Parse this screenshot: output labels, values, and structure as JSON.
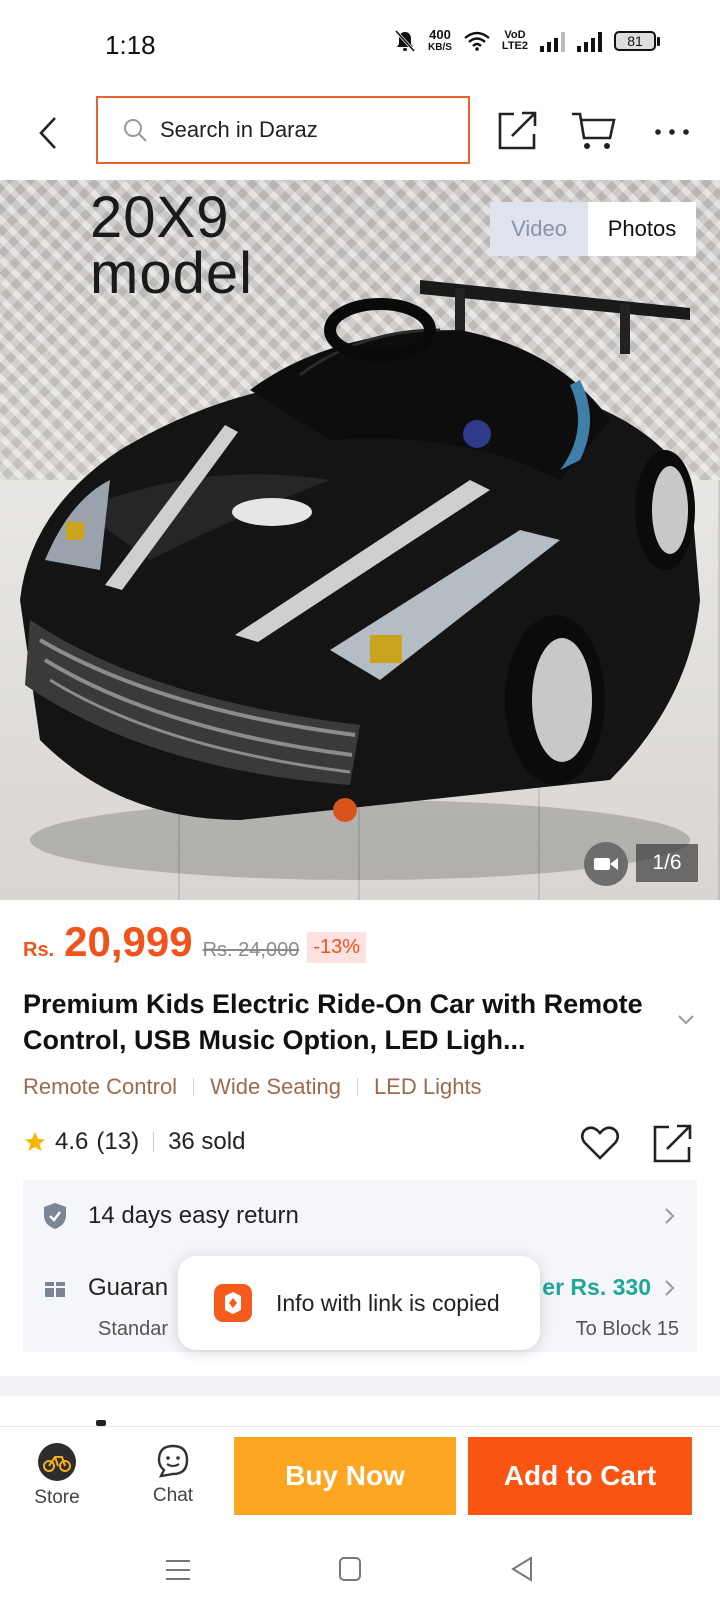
{
  "status_bar": {
    "time": "1:18",
    "speed_value": "400",
    "speed_unit": "KB/S",
    "network_label_top": "VoD",
    "network_label_bottom": "LTE2",
    "battery": "81"
  },
  "header": {
    "search_placeholder": "Search in Daraz",
    "search_border_color": "#e8622b",
    "back_icon": "chevron-left-icon",
    "share_icon": "share-icon",
    "cart_icon": "cart-icon",
    "more_icon": "more-icon"
  },
  "gallery": {
    "overlay_line1": "20X9",
    "overlay_line2": "model",
    "tab_video": "Video",
    "tab_photos": "Photos",
    "counter": "1/6"
  },
  "price": {
    "currency": "Rs.",
    "current": "20,999",
    "original": "Rs. 24,000",
    "discount": "-13%",
    "accent_color": "#f0531c"
  },
  "product": {
    "title": "Premium Kids Electric Ride-On Car with Remote Control, USB Music Option, LED Ligh...",
    "tags": [
      "Remote Control",
      "Wide Seating",
      "LED Lights"
    ],
    "rating": "4.6",
    "reviews": "(13)",
    "sold": "36 sold"
  },
  "services": {
    "return_label": "14 days easy return",
    "guarantee_label": "Guaran",
    "guarantee_sub": "Standar",
    "delivery_fee": "er Rs. 330",
    "delivery_dest": "To Block 15"
  },
  "toast": {
    "message": "Info with link is copied"
  },
  "action_bar": {
    "store_label": "Store",
    "chat_label": "Chat",
    "buy_now": "Buy Now",
    "add_to_cart": "Add to Cart",
    "buy_color": "#fca621",
    "cart_color": "#fa5412"
  }
}
